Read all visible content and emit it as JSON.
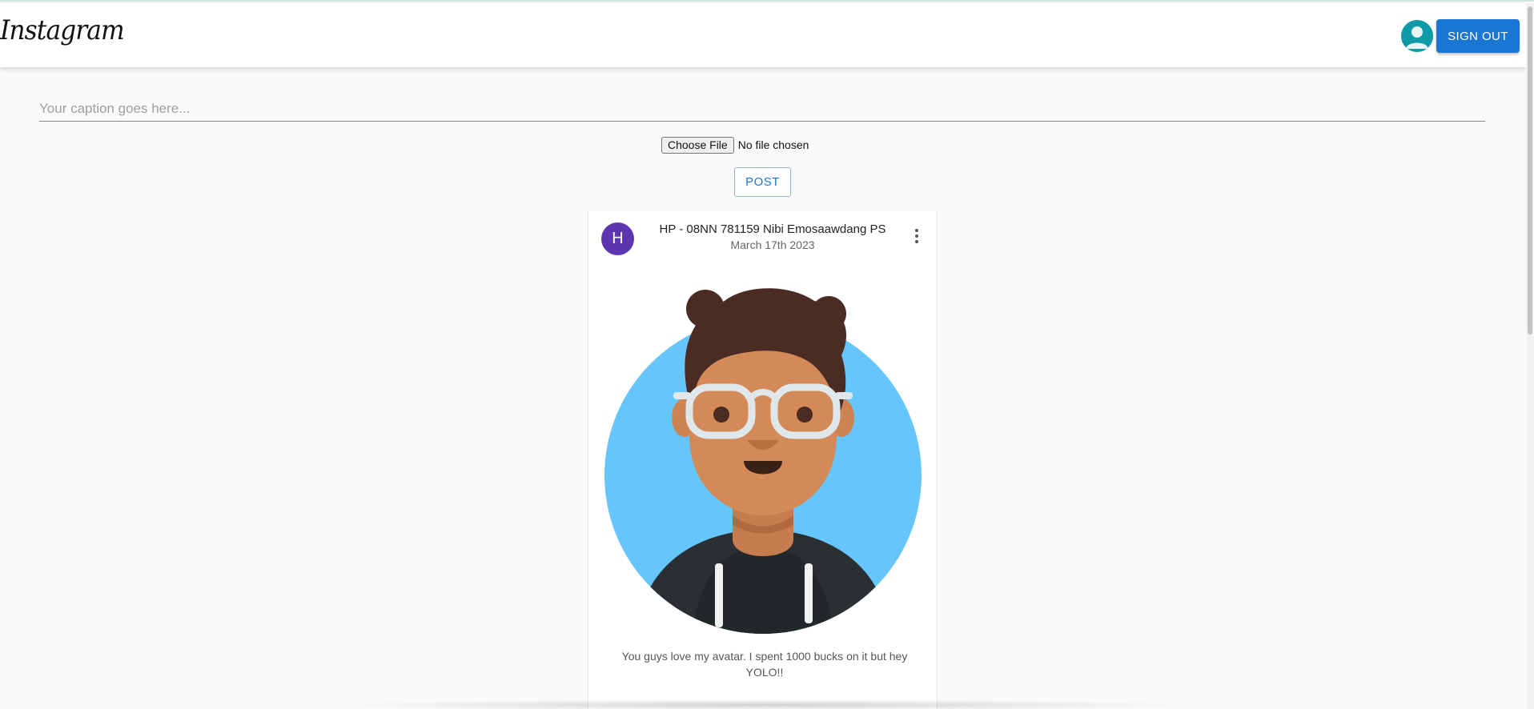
{
  "header": {
    "logo_text": "Instagram",
    "signout_label": "SIGN OUT",
    "avatar_icon": "person-icon"
  },
  "upload": {
    "caption_placeholder": "Your caption goes here...",
    "choose_file_label": "Choose File",
    "file_status": "No file chosen",
    "post_label": "POST"
  },
  "post": {
    "avatar_letter": "H",
    "username": "HP - 08NN 781159 Nibi Emosaawdang PS",
    "date": "March 17th 2023",
    "caption": "You guys love my avatar. I spent 1000 bucks on it but hey YOLO!!",
    "menu_icon": "more-vertical-icon",
    "image_description_icon": "avatar-illustration"
  },
  "colors": {
    "accent": "#1976d2",
    "post_avatar": "#5e35b1",
    "header_avatar": "#0e9aa7",
    "illustration_bg": "#66c5fa"
  }
}
